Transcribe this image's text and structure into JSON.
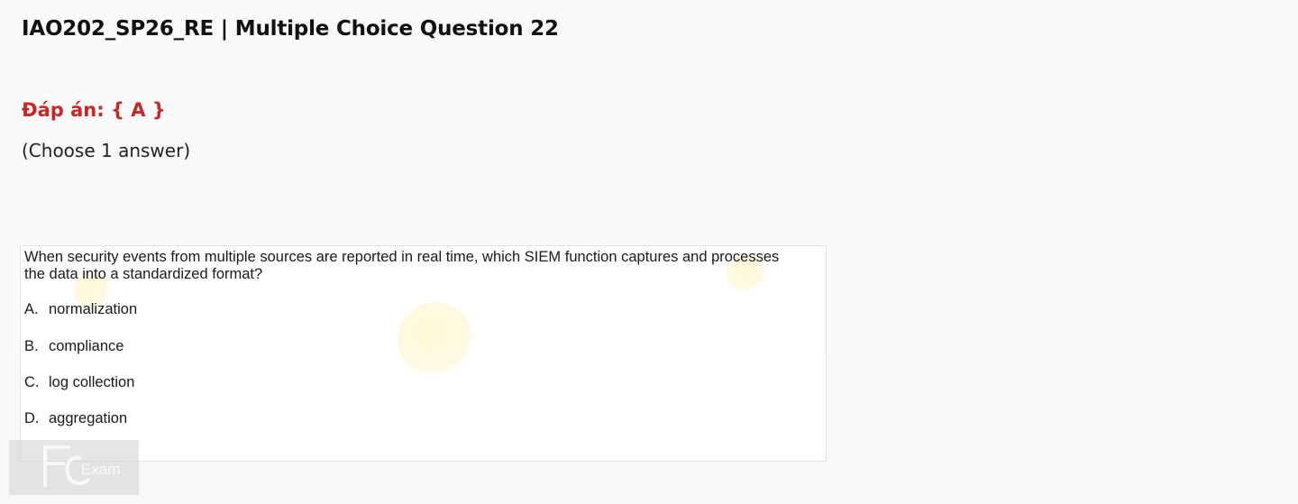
{
  "page": {
    "title": "IAO202_SP26_RE | Multiple Choice Question 22",
    "answer_key": "Đáp án: { A }",
    "instruction": "(Choose 1 answer)"
  },
  "question": {
    "text": "When security events from multiple sources are reported in real time, which SIEM function captures and processes the data into a standardized format?",
    "options": [
      {
        "letter": "A.",
        "text": "normalization"
      },
      {
        "letter": "B.",
        "text": "compliance"
      },
      {
        "letter": "C.",
        "text": "log collection"
      },
      {
        "letter": "D.",
        "text": "aggregation"
      }
    ]
  },
  "watermark": {
    "logo_text": "Exam",
    "icon": "fu-exam-logo-icon"
  },
  "colors": {
    "answer_key": "#c62828",
    "title": "#111111"
  }
}
